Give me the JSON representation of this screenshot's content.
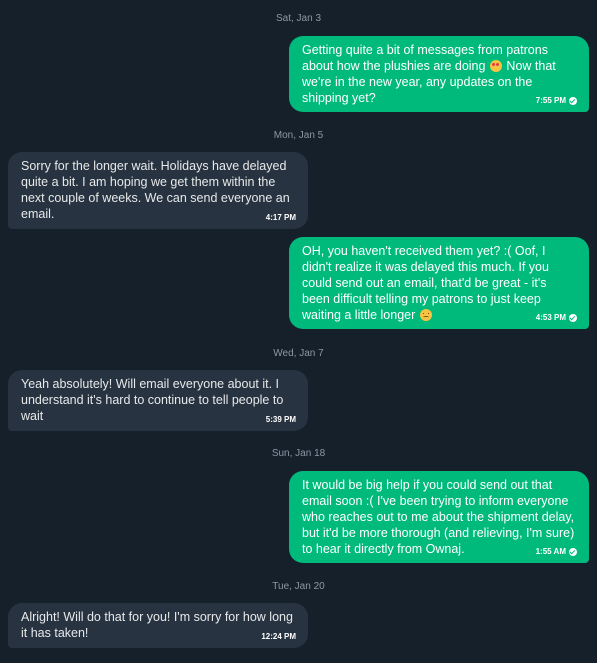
{
  "conversation": {
    "days": [
      {
        "date": "Sat, Jan 3"
      },
      {
        "date": "Mon, Jan 5"
      },
      {
        "date": "Wed, Jan 7"
      },
      {
        "date": "Sun, Jan 18"
      },
      {
        "date": "Tue, Jan 20"
      }
    ],
    "messages": [
      {
        "direction": "outgoing",
        "text_a": "Getting quite a bit of messages from patrons about how the plushies are doing",
        "emoji": "star-struck",
        "text_b": " Now that we're in the new year, any updates on the shipping yet?",
        "time": "7:55 PM",
        "status_icon": "sent-check-icon"
      },
      {
        "direction": "incoming",
        "text": "Sorry for the longer wait. Holidays have delayed quite a bit. I am hoping we get them within the next couple of weeks. We can send everyone an email.",
        "time": "4:17 PM"
      },
      {
        "direction": "outgoing",
        "text_a": "OH, you haven't received them yet? :( Oof, I didn't realize it was delayed this much. If you could send out an email, that'd be great - it's been difficult telling my patrons to just keep waiting a little longer",
        "emoji": "persevering-face",
        "time": "4:53 PM",
        "status_icon": "sent-check-icon"
      },
      {
        "direction": "incoming",
        "text": "Yeah absolutely! Will email everyone about it. I understand it's hard to continue to tell people to wait",
        "time": "5:39 PM"
      },
      {
        "direction": "outgoing",
        "text_a": "It would be big help if you could send out that email soon :( I've been trying to inform everyone who reaches out to me about the shipment delay, but it'd be more thorough (and relieving, I'm sure) to hear it directly from Ownaj.",
        "time": "1:55 AM",
        "status_icon": "sent-check-icon"
      },
      {
        "direction": "incoming",
        "text": "Alright! Will do that for you! I'm sorry for how long it has taken!",
        "time": "12:24 PM"
      }
    ]
  },
  "colors": {
    "background": "#15202b",
    "outgoing_bubble": "#00ba7c",
    "incoming_bubble": "#273340",
    "date_text": "#8b98a5"
  }
}
